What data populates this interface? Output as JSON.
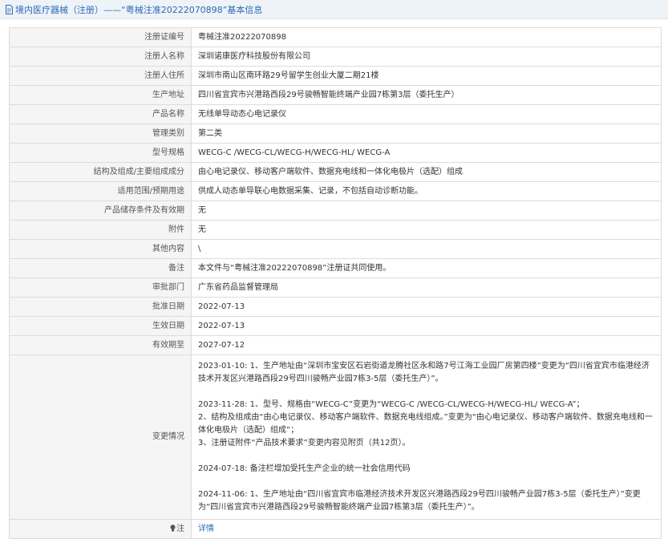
{
  "header": {
    "title": "境内医疗器械（注册）——“粤械注准20222070898”基本信息"
  },
  "rows": [
    {
      "label": "注册证编号",
      "value": "粤械注准20222070898"
    },
    {
      "label": "注册人名称",
      "value": "深圳诺康医疗科技股份有限公司"
    },
    {
      "label": "注册人住所",
      "value": "深圳市南山区南环路29号留学生创业大厦二期21楼"
    },
    {
      "label": "生产地址",
      "value": "四川省宜宾市兴港路西段29号骏畅智能终端产业园7栋第3层（委托生产）"
    },
    {
      "label": "产品名称",
      "value": "无线单导动态心电记录仪"
    },
    {
      "label": "管理类别",
      "value": "第二类"
    },
    {
      "label": "型号规格",
      "value": "WECG-C /WECG-CL/WECG-H/WECG-HL/ WECG-A"
    },
    {
      "label": "结构及组成/主要组成成分",
      "value": "由心电记录仪、移动客户端软件、数据充电线和一体化电极片（选配）组成"
    },
    {
      "label": "适用范围/预期用途",
      "value": "供成人动态单导联心电数据采集、记录，不包括自动诊断功能。"
    },
    {
      "label": "产品储存条件及有效期",
      "value": "无"
    },
    {
      "label": "附件",
      "value": "无"
    },
    {
      "label": "其他内容",
      "value": "\\"
    },
    {
      "label": "备注",
      "value": "本文件与“粤械注准20222070898”注册证共同使用。"
    },
    {
      "label": "审批部门",
      "value": "广东省药品监督管理局"
    },
    {
      "label": "批准日期",
      "value": "2022-07-13"
    },
    {
      "label": "生效日期",
      "value": "2022-07-13"
    },
    {
      "label": "有效期至",
      "value": "2027-07-12"
    }
  ],
  "changes": {
    "label": "变更情况",
    "entries": [
      "2023-01-10: 1、生产地址由“深圳市宝安区石岩街道龙腾社区永和路7号江海工业园厂房第四楼”变更为“四川省宜宾市临港经济技术开发区兴港路西段29号四川骏畅产业园7栋3-5层（委托生产）”。",
      "2023-11-28: 1、型号、规格由“WECG-C”变更为“WECG-C /WECG-CL/WECG-H/WECG-HL/ WECG-A”；\n2、结构及组成由“由心电记录仪、移动客户端软件、数据充电线组成。”变更为“由心电记录仪、移动客户端软件、数据充电线和一体化电极片（选配）组成”；\n3、注册证附件“产品技术要求”变更内容见附页（共12页）。",
      "2024-07-18: 备注栏增加受托生产企业的统一社会信用代码",
      "2024-11-06: 1、生产地址由“四川省宜宾市临港经济技术开发区兴港路西段29号四川骏畅产业园7栋3-5层（委托生产）”变更为“四川省宜宾市兴港路西段29号骏畅智能终端产业园7栋第3层（委托生产）”。"
    ]
  },
  "note": {
    "label": "注",
    "link": "详情"
  },
  "colors": {
    "title_blue": "#2d6ab5",
    "label_bg": "#f5f5f5",
    "header_bg": "#eef3f8",
    "border": "#dcdcdc"
  }
}
